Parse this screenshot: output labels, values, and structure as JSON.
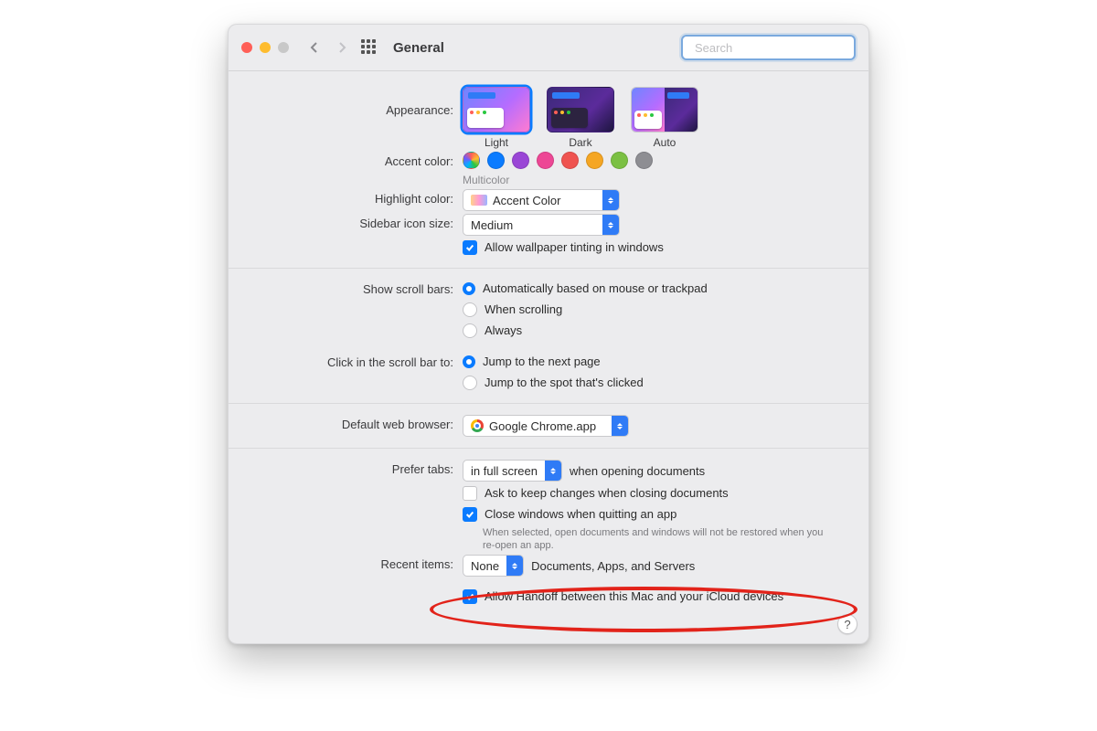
{
  "toolbar": {
    "title": "General",
    "search_placeholder": "Search"
  },
  "appearance": {
    "label": "Appearance:",
    "options": {
      "light": "Light",
      "dark": "Dark",
      "auto": "Auto"
    },
    "selected": "light"
  },
  "accent": {
    "label": "Accent color:",
    "caption": "Multicolor",
    "colors": [
      "multicolor",
      "#0a7bff",
      "#9a46d6",
      "#ed4795",
      "#ef5350",
      "#f5a623",
      "#7bc043",
      "#8e8e93"
    ]
  },
  "highlight": {
    "label": "Highlight color:",
    "value": "Accent Color"
  },
  "sidebar_size": {
    "label": "Sidebar icon size:",
    "value": "Medium"
  },
  "wallpaper_tint": {
    "label": "Allow wallpaper tinting in windows",
    "checked": true
  },
  "scrollbars": {
    "label": "Show scroll bars:",
    "options": [
      "Automatically based on mouse or trackpad",
      "When scrolling",
      "Always"
    ],
    "selected": 0
  },
  "click_scroll": {
    "label": "Click in the scroll bar to:",
    "options": [
      "Jump to the next page",
      "Jump to the spot that's clicked"
    ],
    "selected": 0
  },
  "browser": {
    "label": "Default web browser:",
    "value": "Google Chrome.app"
  },
  "tabs": {
    "label": "Prefer tabs:",
    "value": "in full screen",
    "suffix": "when opening documents"
  },
  "ask_keep": {
    "label": "Ask to keep changes when closing documents",
    "checked": false
  },
  "close_windows": {
    "label": "Close windows when quitting an app",
    "checked": true,
    "hint": "When selected, open documents and windows will not be restored when you re-open an app."
  },
  "recent": {
    "label": "Recent items:",
    "value": "None",
    "suffix": "Documents, Apps, and Servers"
  },
  "handoff": {
    "label": "Allow Handoff between this Mac and your iCloud devices",
    "checked": true
  },
  "help": "?"
}
